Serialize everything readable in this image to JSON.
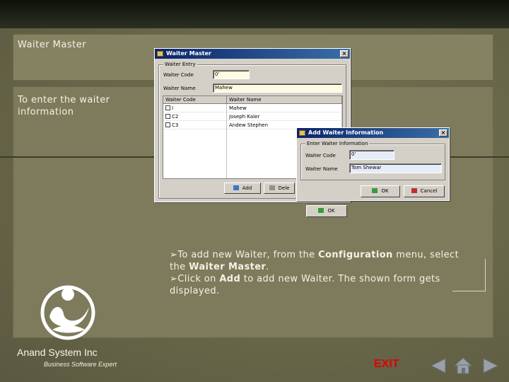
{
  "slide": {
    "title": "Waiter Master",
    "subtitle": "To enter the waiter information",
    "instructions": [
      {
        "pre": "To add new Waiter, from the ",
        "b1": "Configuration",
        "mid": " menu, select the ",
        "b2": "Waiter Master",
        "post": "."
      },
      {
        "pre": "Click on ",
        "b1": "Add",
        "mid": " to add new Waiter. The shown form gets displayed.",
        "b2": "",
        "post": ""
      }
    ]
  },
  "waiter_master_window": {
    "title": "Waiter Master",
    "close": "×",
    "group_label": "Waiter Entry",
    "code_label": "Waiter Code",
    "code_value": "0'",
    "name_label": "Waiter Name",
    "name_value": "Mahew",
    "grid_headers": [
      "Waiter Code",
      "Waiter Name"
    ],
    "grid_rows": [
      {
        "code": "I",
        "name": "Mahew"
      },
      {
        "code": "C2",
        "name": "Joseph Kaler"
      },
      {
        "code": "C3",
        "name": "Andew Stephen"
      }
    ],
    "add_label": "Add",
    "delete_label": "Dele",
    "ok_label": "OK"
  },
  "add_waiter_window": {
    "title": "Add Waiter Information",
    "close": "×",
    "group_label": "Enter Waiter Information",
    "code_label": "Waiter Code",
    "code_value": "0'",
    "name_label": "Waiter Name",
    "name_value": "Tom Shewar",
    "ok_label": "OK",
    "cancel_label": "Cancel"
  },
  "branding": {
    "company": "Anand System Inc",
    "tagline": "Business Software Expert"
  },
  "nav": {
    "exit_label": "EXIT",
    "icons": [
      "prev-arrow-icon",
      "home-icon",
      "next-arrow-icon"
    ]
  },
  "colors": {
    "exit": "#e00000",
    "title_bar": "#0a246a",
    "background": "#6d6b4e"
  }
}
